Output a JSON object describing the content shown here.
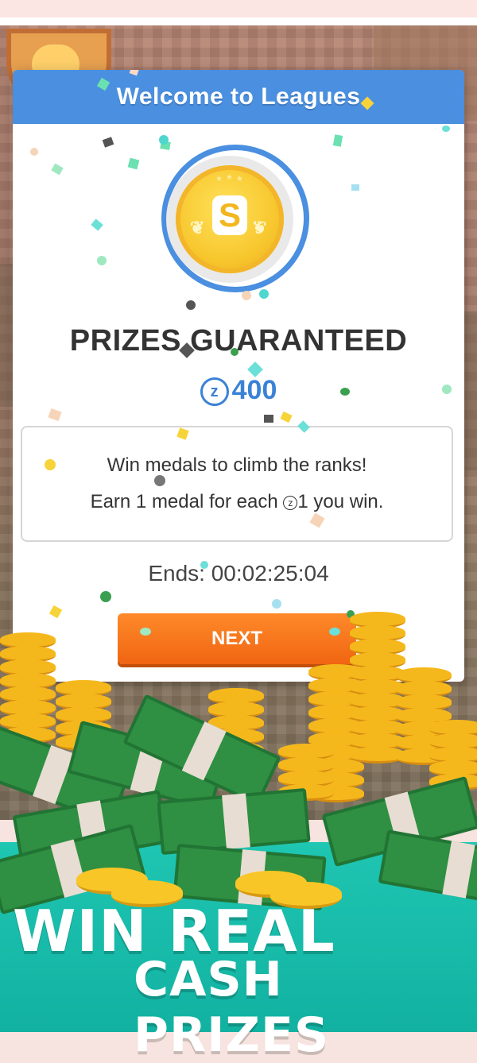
{
  "modal": {
    "title": "Welcome to Leagues",
    "medal_icon": "league-medal-s",
    "prizes_heading": "PRIZES GUARANTEED",
    "prize_currency_symbol": "z",
    "prize_amount": "400",
    "info_line_1": "Win medals to climb the ranks!",
    "info_line_2_before": "Earn 1 medal for each ",
    "info_line_2_symbol": "z",
    "info_line_2_after": "1 you win.",
    "ends_text": "Ends: 00:02:25:04",
    "next_label": "NEXT",
    "coin_letter": "S"
  },
  "promo": {
    "line_1": "WIN REAL",
    "line_2": "CASH PRIZES"
  },
  "colors": {
    "header_blue": "#4a8fe0",
    "amount_blue": "#3b82d6",
    "button_orange": "#f06512",
    "teal_band": "#1fc6b2",
    "coin_gold": "#f7c62d"
  }
}
